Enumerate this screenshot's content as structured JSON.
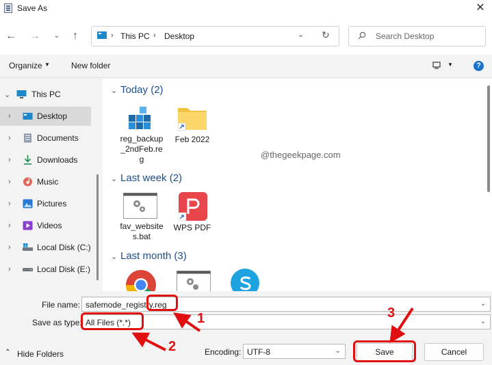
{
  "window": {
    "title": "Save As"
  },
  "nav": {
    "path": [
      "This PC",
      "Desktop"
    ],
    "search_placeholder": "Search Desktop"
  },
  "toolbar": {
    "organize": "Organize",
    "new_folder": "New folder"
  },
  "sidebar": {
    "items": [
      {
        "label": "This PC"
      },
      {
        "label": "Desktop"
      },
      {
        "label": "Documents"
      },
      {
        "label": "Downloads"
      },
      {
        "label": "Music"
      },
      {
        "label": "Pictures"
      },
      {
        "label": "Videos"
      },
      {
        "label": "Local Disk (C:)"
      },
      {
        "label": "Local Disk (E:)"
      }
    ]
  },
  "content": {
    "groups": [
      {
        "label": "Today (2)",
        "files": [
          {
            "name_lines": [
              "reg_backup",
              "_2ndFeb.re",
              "g"
            ]
          },
          {
            "name_lines": [
              "Feb 2022"
            ]
          }
        ]
      },
      {
        "label": "Last week (2)",
        "files": [
          {
            "name_lines": [
              "fav_website",
              "s.bat"
            ]
          },
          {
            "name_lines": [
              "WPS PDF"
            ]
          }
        ]
      },
      {
        "label": "Last month (3)"
      }
    ],
    "watermark": "@thegeekpage.com"
  },
  "form": {
    "file_name_label": "File name:",
    "file_name_value": "safemode_registry.reg",
    "save_type_label": "Save as type:",
    "save_type_value": "All Files  (*.*)",
    "encoding_label": "Encoding:",
    "encoding_value": "UTF-8",
    "hide_folders": "Hide Folders",
    "save": "Save",
    "cancel": "Cancel"
  },
  "annotations": [
    "1",
    "2",
    "3"
  ],
  "colors": {
    "accent": "#1d4e89",
    "annotation": "#e01010",
    "selected": "#d9d9d9"
  }
}
